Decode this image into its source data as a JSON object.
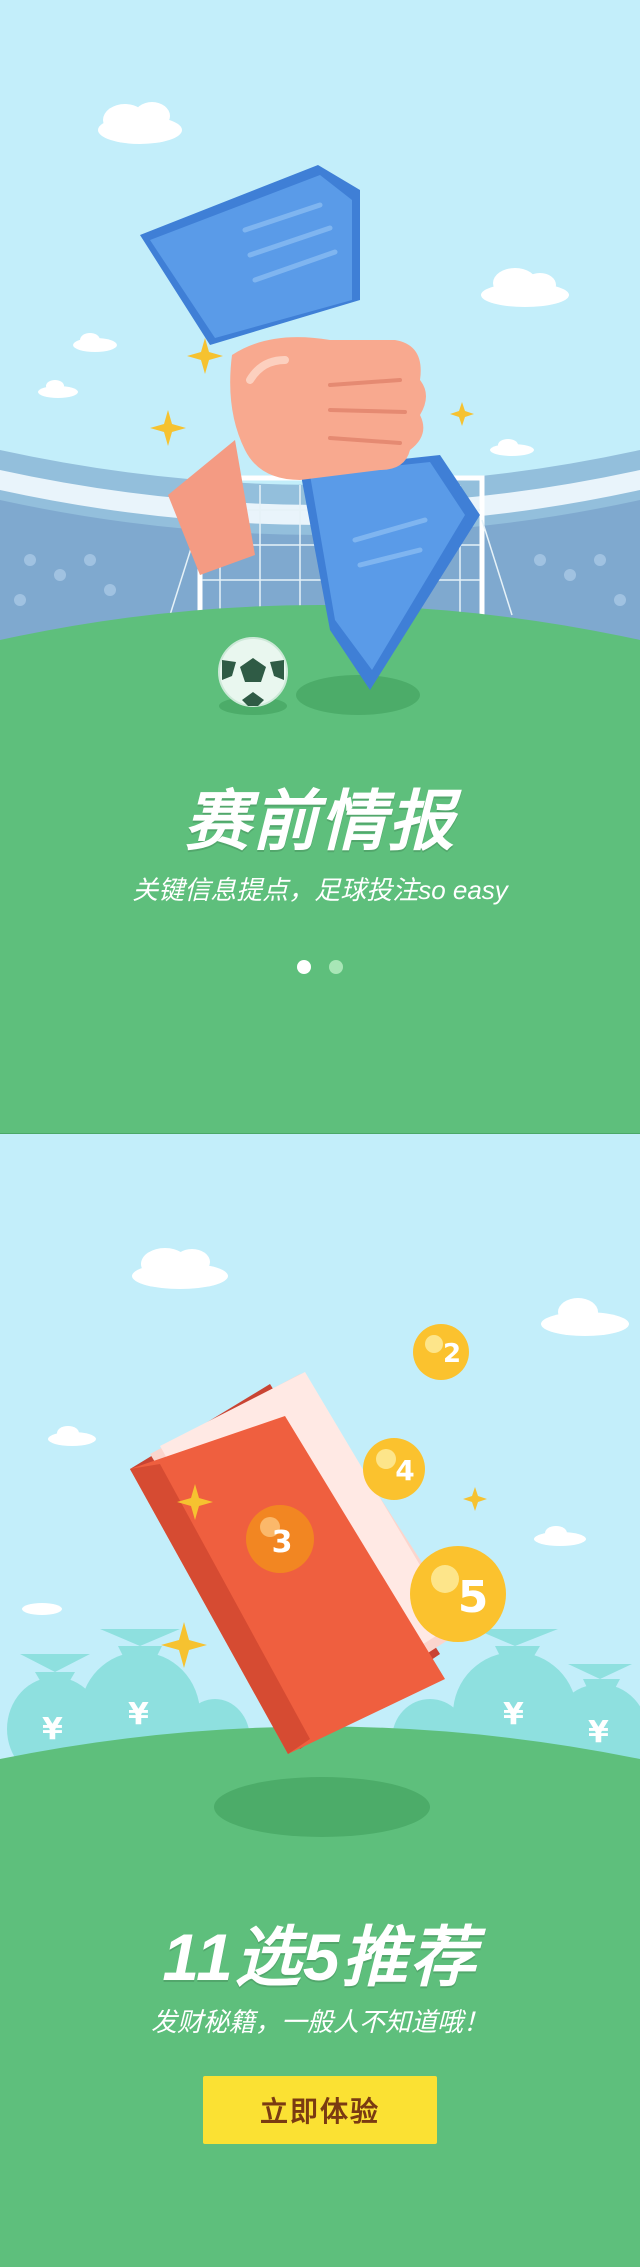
{
  "slides": [
    {
      "title": "赛前情报",
      "subtitle": "关键信息提点，足球投注so easy",
      "illustration": "hand-holding-newspaper-stadium"
    },
    {
      "title": "11选5推荐",
      "subtitle": "发财秘籍，一般人不知道哦！",
      "illustration": "red-book-lottery-balls",
      "balls": [
        "2",
        "4",
        "3",
        "5"
      ],
      "money_symbol": "¥",
      "button_label": "立即体验"
    }
  ],
  "pager": {
    "count": 2,
    "active_index": 0
  },
  "colors": {
    "sky": "#c3eefa",
    "grass": "#5ebf7c",
    "grass_dark": "#4cac69",
    "button": "#fbe133",
    "button_text": "#7a3b12",
    "ball": "#fbc22e"
  }
}
